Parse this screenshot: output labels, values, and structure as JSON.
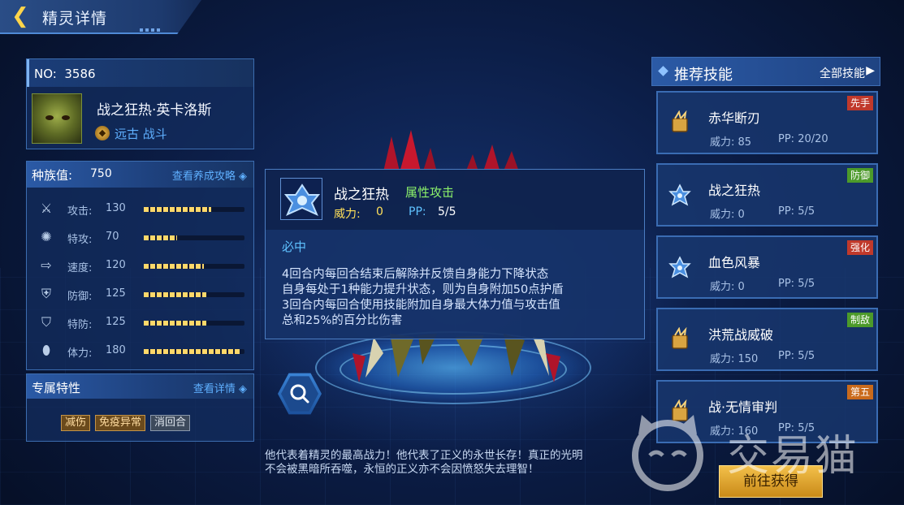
{
  "header": {
    "title": "精灵详情"
  },
  "pet": {
    "no_label": "NO:",
    "no_value": "3586",
    "name": "战之狂热·英卡洛斯",
    "type": "远古 战斗"
  },
  "stats": {
    "total_label": "种族值:",
    "total_value": "750",
    "guide_link": "查看养成攻略",
    "items": [
      {
        "name": "攻击:",
        "value": "130",
        "fill": 0.67,
        "icon": "sword-icon"
      },
      {
        "name": "特攻:",
        "value": "70",
        "fill": 0.33,
        "icon": "magic-icon"
      },
      {
        "name": "速度:",
        "value": "120",
        "fill": 0.6,
        "icon": "boot-icon"
      },
      {
        "name": "防御:",
        "value": "125",
        "fill": 0.62,
        "icon": "shield-icon"
      },
      {
        "name": "特防:",
        "value": "125",
        "fill": 0.62,
        "icon": "magic-shield-icon"
      },
      {
        "name": "体力:",
        "value": "180",
        "fill": 0.97,
        "icon": "pill-icon"
      }
    ]
  },
  "traits": {
    "label": "专属特性",
    "detail_link": "查看详情",
    "tags": [
      "减伤",
      "免疫异常",
      "消回合"
    ]
  },
  "skill_detail": {
    "name": "战之狂热",
    "type": "属性攻击",
    "power_label": "威力:",
    "power_value": "0",
    "pp_label": "PP:",
    "pp_value": "5/5",
    "hit": "必中",
    "desc_lines": [
      "4回合内每回合结束后解除并反馈自身能力下降状态",
      "自身每处于1种能力提升状态，则为自身附加50点护盾",
      "3回合内每回合使用技能附加自身最大体力值与攻击值",
      "总和25%的百分比伤害"
    ]
  },
  "quote": {
    "line1": "他代表着精灵的最高战力！他代表了正义的永世长存！真正的光明",
    "line2": "不会被黑暗所吞噬，永恒的正义亦不会因愤怒失去理智！"
  },
  "recommend": {
    "label": "推荐技能",
    "all_label": "全部技能",
    "skills": [
      {
        "name": "赤华断刃",
        "power": "威力: 85",
        "pp": "PP:  20/20",
        "badge": "先手",
        "badge_color": "#c0392b",
        "icon": "fighting-type-icon"
      },
      {
        "name": "战之狂热",
        "power": "威力: 0",
        "pp": "PP:  5/5",
        "badge": "防御",
        "badge_color": "#4c9a2a",
        "icon": "status-star-icon"
      },
      {
        "name": "血色风暴",
        "power": "威力: 0",
        "pp": "PP:  5/5",
        "badge": "强化",
        "badge_color": "#c0392b",
        "icon": "status-star-icon"
      },
      {
        "name": "洪荒战威破",
        "power": "威力: 150",
        "pp": "PP:  5/5",
        "badge": "制敌",
        "badge_color": "#4c9a2a",
        "icon": "fighting-type-icon"
      },
      {
        "name": "战·无情审判",
        "power": "威力: 160",
        "pp": "PP:  5/5",
        "badge": "第五",
        "badge_color": "#c96a1c",
        "icon": "fighting-type-icon"
      }
    ]
  },
  "go_button": "前往获得",
  "watermark": "交易猫"
}
